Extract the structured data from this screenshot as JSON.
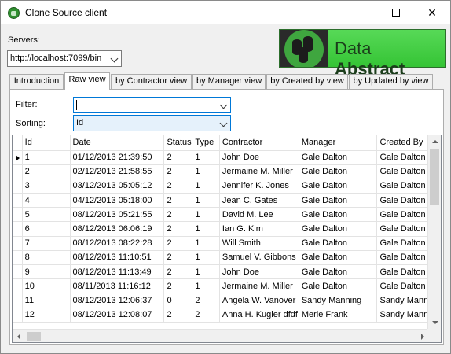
{
  "window": {
    "title": "Clone Source client"
  },
  "servers": {
    "label": "Servers:",
    "value": "http://localhost:7099/bin"
  },
  "logo": {
    "text_light": "Data ",
    "text_bold": "Abstract"
  },
  "tabs": [
    {
      "label": "Introduction"
    },
    {
      "label": "Raw view"
    },
    {
      "label": "by Contractor view"
    },
    {
      "label": "by Manager view"
    },
    {
      "label": "by Created by view"
    },
    {
      "label": "by Updated by view"
    }
  ],
  "active_tab": "Raw view",
  "filter": {
    "label": "Filter:",
    "value": ""
  },
  "sorting": {
    "label": "Sorting:",
    "value": "Id"
  },
  "grid": {
    "columns": [
      "Id",
      "Date",
      "Status",
      "Type",
      "Contractor",
      "Manager",
      "Created By"
    ],
    "rows": [
      [
        "1",
        "01/12/2013 21:39:50",
        "2",
        "1",
        "John Doe",
        "Gale Dalton",
        "Gale Dalton"
      ],
      [
        "2",
        "02/12/2013 21:58:55",
        "2",
        "1",
        "Jermaine M. Miller",
        "Gale Dalton",
        "Gale Dalton"
      ],
      [
        "3",
        "03/12/2013 05:05:12",
        "2",
        "1",
        "Jennifer K. Jones",
        "Gale Dalton",
        "Gale Dalton"
      ],
      [
        "4",
        "04/12/2013 05:18:00",
        "2",
        "1",
        "Jean C. Gates",
        "Gale Dalton",
        "Gale Dalton"
      ],
      [
        "5",
        "08/12/2013 05:21:55",
        "2",
        "1",
        "David M. Lee",
        "Gale Dalton",
        "Gale Dalton"
      ],
      [
        "6",
        "08/12/2013 06:06:19",
        "2",
        "1",
        "Ian G. Kim",
        "Gale Dalton",
        "Gale Dalton"
      ],
      [
        "7",
        "08/12/2013 08:22:28",
        "2",
        "1",
        "Will Smith",
        "Gale Dalton",
        "Gale Dalton"
      ],
      [
        "8",
        "08/12/2013 11:10:51",
        "2",
        "1",
        "Samuel V. Gibbons",
        "Gale Dalton",
        "Gale Dalton"
      ],
      [
        "9",
        "08/12/2013 11:13:49",
        "2",
        "1",
        "John Doe",
        "Gale Dalton",
        "Gale Dalton"
      ],
      [
        "10",
        "08/11/2013 11:16:12",
        "2",
        "1",
        "Jermaine M. Miller",
        "Gale Dalton",
        "Gale Dalton"
      ],
      [
        "11",
        "08/12/2013 12:06:37",
        "0",
        "2",
        "Angela W. Vanover",
        "Sandy Manning",
        "Sandy Manning"
      ],
      [
        "12",
        "08/12/2013 12:08:07",
        "2",
        "2",
        "Anna H. Kugler dfdf",
        "Merle Frank",
        "Sandy Manning"
      ]
    ],
    "current_row": 1
  },
  "colors": {
    "logo_green": "#3fc23f",
    "focus_blue": "#0078d7"
  }
}
